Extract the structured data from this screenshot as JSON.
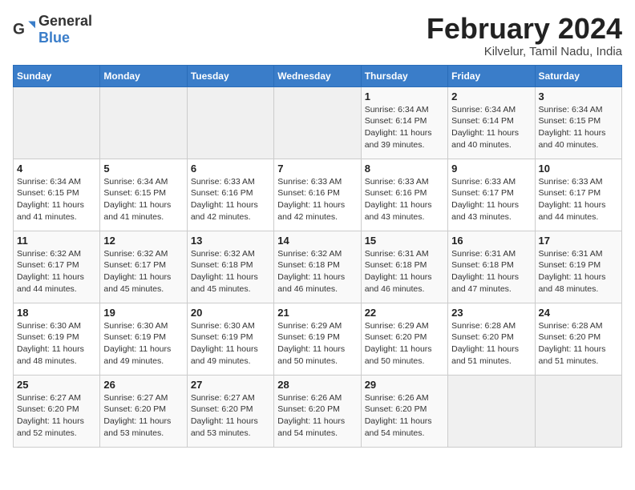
{
  "header": {
    "logo_general": "General",
    "logo_blue": "Blue",
    "month_year": "February 2024",
    "location": "Kilvelur, Tamil Nadu, India"
  },
  "days_of_week": [
    "Sunday",
    "Monday",
    "Tuesday",
    "Wednesday",
    "Thursday",
    "Friday",
    "Saturday"
  ],
  "weeks": [
    [
      {
        "day": "",
        "info": ""
      },
      {
        "day": "",
        "info": ""
      },
      {
        "day": "",
        "info": ""
      },
      {
        "day": "",
        "info": ""
      },
      {
        "day": "1",
        "info": "Sunrise: 6:34 AM\nSunset: 6:14 PM\nDaylight: 11 hours\nand 39 minutes."
      },
      {
        "day": "2",
        "info": "Sunrise: 6:34 AM\nSunset: 6:14 PM\nDaylight: 11 hours\nand 40 minutes."
      },
      {
        "day": "3",
        "info": "Sunrise: 6:34 AM\nSunset: 6:15 PM\nDaylight: 11 hours\nand 40 minutes."
      }
    ],
    [
      {
        "day": "4",
        "info": "Sunrise: 6:34 AM\nSunset: 6:15 PM\nDaylight: 11 hours\nand 41 minutes."
      },
      {
        "day": "5",
        "info": "Sunrise: 6:34 AM\nSunset: 6:15 PM\nDaylight: 11 hours\nand 41 minutes."
      },
      {
        "day": "6",
        "info": "Sunrise: 6:33 AM\nSunset: 6:16 PM\nDaylight: 11 hours\nand 42 minutes."
      },
      {
        "day": "7",
        "info": "Sunrise: 6:33 AM\nSunset: 6:16 PM\nDaylight: 11 hours\nand 42 minutes."
      },
      {
        "day": "8",
        "info": "Sunrise: 6:33 AM\nSunset: 6:16 PM\nDaylight: 11 hours\nand 43 minutes."
      },
      {
        "day": "9",
        "info": "Sunrise: 6:33 AM\nSunset: 6:17 PM\nDaylight: 11 hours\nand 43 minutes."
      },
      {
        "day": "10",
        "info": "Sunrise: 6:33 AM\nSunset: 6:17 PM\nDaylight: 11 hours\nand 44 minutes."
      }
    ],
    [
      {
        "day": "11",
        "info": "Sunrise: 6:32 AM\nSunset: 6:17 PM\nDaylight: 11 hours\nand 44 minutes."
      },
      {
        "day": "12",
        "info": "Sunrise: 6:32 AM\nSunset: 6:17 PM\nDaylight: 11 hours\nand 45 minutes."
      },
      {
        "day": "13",
        "info": "Sunrise: 6:32 AM\nSunset: 6:18 PM\nDaylight: 11 hours\nand 45 minutes."
      },
      {
        "day": "14",
        "info": "Sunrise: 6:32 AM\nSunset: 6:18 PM\nDaylight: 11 hours\nand 46 minutes."
      },
      {
        "day": "15",
        "info": "Sunrise: 6:31 AM\nSunset: 6:18 PM\nDaylight: 11 hours\nand 46 minutes."
      },
      {
        "day": "16",
        "info": "Sunrise: 6:31 AM\nSunset: 6:18 PM\nDaylight: 11 hours\nand 47 minutes."
      },
      {
        "day": "17",
        "info": "Sunrise: 6:31 AM\nSunset: 6:19 PM\nDaylight: 11 hours\nand 48 minutes."
      }
    ],
    [
      {
        "day": "18",
        "info": "Sunrise: 6:30 AM\nSunset: 6:19 PM\nDaylight: 11 hours\nand 48 minutes."
      },
      {
        "day": "19",
        "info": "Sunrise: 6:30 AM\nSunset: 6:19 PM\nDaylight: 11 hours\nand 49 minutes."
      },
      {
        "day": "20",
        "info": "Sunrise: 6:30 AM\nSunset: 6:19 PM\nDaylight: 11 hours\nand 49 minutes."
      },
      {
        "day": "21",
        "info": "Sunrise: 6:29 AM\nSunset: 6:19 PM\nDaylight: 11 hours\nand 50 minutes."
      },
      {
        "day": "22",
        "info": "Sunrise: 6:29 AM\nSunset: 6:20 PM\nDaylight: 11 hours\nand 50 minutes."
      },
      {
        "day": "23",
        "info": "Sunrise: 6:28 AM\nSunset: 6:20 PM\nDaylight: 11 hours\nand 51 minutes."
      },
      {
        "day": "24",
        "info": "Sunrise: 6:28 AM\nSunset: 6:20 PM\nDaylight: 11 hours\nand 51 minutes."
      }
    ],
    [
      {
        "day": "25",
        "info": "Sunrise: 6:27 AM\nSunset: 6:20 PM\nDaylight: 11 hours\nand 52 minutes."
      },
      {
        "day": "26",
        "info": "Sunrise: 6:27 AM\nSunset: 6:20 PM\nDaylight: 11 hours\nand 53 minutes."
      },
      {
        "day": "27",
        "info": "Sunrise: 6:27 AM\nSunset: 6:20 PM\nDaylight: 11 hours\nand 53 minutes."
      },
      {
        "day": "28",
        "info": "Sunrise: 6:26 AM\nSunset: 6:20 PM\nDaylight: 11 hours\nand 54 minutes."
      },
      {
        "day": "29",
        "info": "Sunrise: 6:26 AM\nSunset: 6:20 PM\nDaylight: 11 hours\nand 54 minutes."
      },
      {
        "day": "",
        "info": ""
      },
      {
        "day": "",
        "info": ""
      }
    ]
  ]
}
